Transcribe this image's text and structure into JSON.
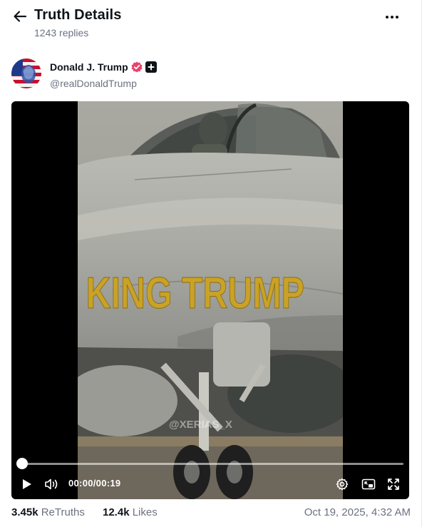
{
  "header": {
    "title": "Truth Details",
    "replies": "1243 replies",
    "back_icon": "arrow-left-icon",
    "more_icon": "ellipsis-icon"
  },
  "author": {
    "display_name": "Donald J. Trump",
    "handle": "@realDonaldTrump",
    "verified_color": "#e9446a"
  },
  "video": {
    "overlay_text": "KING TRUMP",
    "watermark": "@XERIAS_X",
    "time_current": "00:00",
    "time_separator": "/",
    "time_total": "00:19",
    "progress": 0,
    "controls": {
      "play_icon": "play-icon",
      "volume_icon": "volume-icon",
      "settings_icon": "settings-gear-icon",
      "pip_icon": "picture-in-picture-icon",
      "fullscreen_icon": "fullscreen-icon"
    }
  },
  "stats": {
    "retruths_count": "3.45k",
    "retruths_label": "ReTruths",
    "likes_count": "12.4k",
    "likes_label": "Likes",
    "timestamp": "Oct 19, 2025, 4:32 AM"
  },
  "colors": {
    "text_primary": "#0f1419",
    "text_secondary": "#6b7280",
    "accent_badge": "#e9446a"
  }
}
